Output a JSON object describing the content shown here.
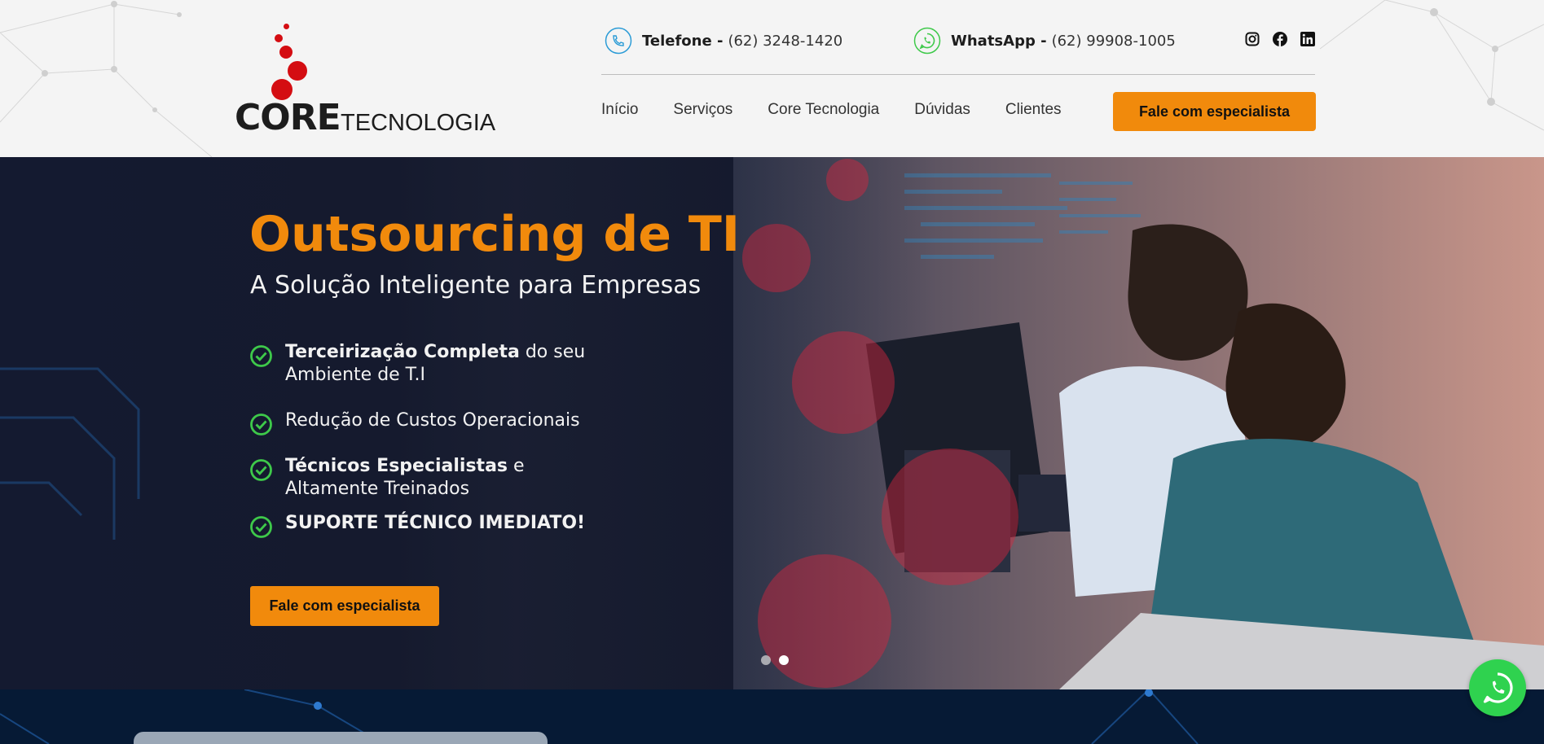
{
  "brand": {
    "logo_word": "CORE",
    "logo_sub": "TECNOLOGIA"
  },
  "contacts": {
    "phone_label": "Telefone -",
    "phone_number": "(62) 3248-1420",
    "whatsapp_label": "WhatsApp -",
    "whatsapp_number": "(62) 99908-1005"
  },
  "social": [
    "instagram-icon",
    "facebook-icon",
    "linkedin-icon"
  ],
  "nav": {
    "items": [
      "Início",
      "Serviços",
      "Core Tecnologia",
      "Dúvidas",
      "Clientes"
    ],
    "cta": "Fale com especialista"
  },
  "hero": {
    "title": "Outsourcing de TI",
    "subtitle": "A Solução Inteligente para Empresas",
    "bullets": [
      {
        "strong": "Terceirização Completa",
        "rest": " do seu",
        "line2": "Ambiente de T.I"
      },
      {
        "strong": "",
        "rest": "Redução de Custos Operacionais",
        "line2": ""
      },
      {
        "strong": "Técnicos Especialistas",
        "rest": " e",
        "line2": "Altamente Treinados"
      },
      {
        "strong": "SUPORTE TÉCNICO IMEDIATO!",
        "rest": "",
        "line2": ""
      }
    ],
    "cta": "Fale com especialista",
    "slides": 2,
    "active_slide": 2
  },
  "colors": {
    "accent": "#f18a0c",
    "brand_red": "#d40d12",
    "check_green": "#3ec94a",
    "whatsapp_green": "#2fd24f"
  }
}
